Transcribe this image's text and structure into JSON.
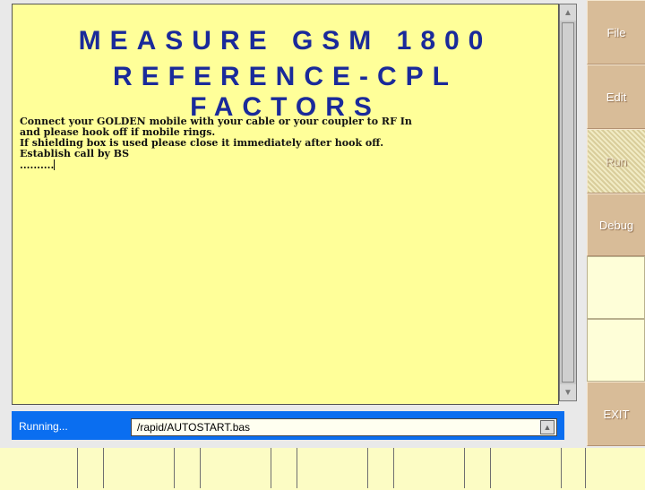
{
  "title": {
    "line1": "MEASURE GSM 1800",
    "line2": "REFERENCE-CPL FACTORS"
  },
  "console": {
    "lines": [
      "Connect your GOLDEN mobile with your cable or your coupler to RF In",
      "and please hook off if mobile rings.",
      "If shielding box is used please close it immediately after hook off.",
      "Establish call by BS",
      ".........."
    ]
  },
  "status": {
    "text": "Running...",
    "path": "/rapid/AUTOSTART.bas"
  },
  "side_menu": {
    "file": "File",
    "edit": "Edit",
    "run": "Run",
    "debug": "Debug",
    "exit": "EXIT"
  },
  "colors": {
    "screen_bg": "#ffff99",
    "title": "#1a2a9a",
    "status_bar": "#0a6ef0",
    "side_button": "#d8bc98"
  },
  "icons": {
    "scroll_up": "triangle-up-icon",
    "scroll_down": "triangle-down-icon",
    "dropdown": "triangle-down-icon"
  }
}
